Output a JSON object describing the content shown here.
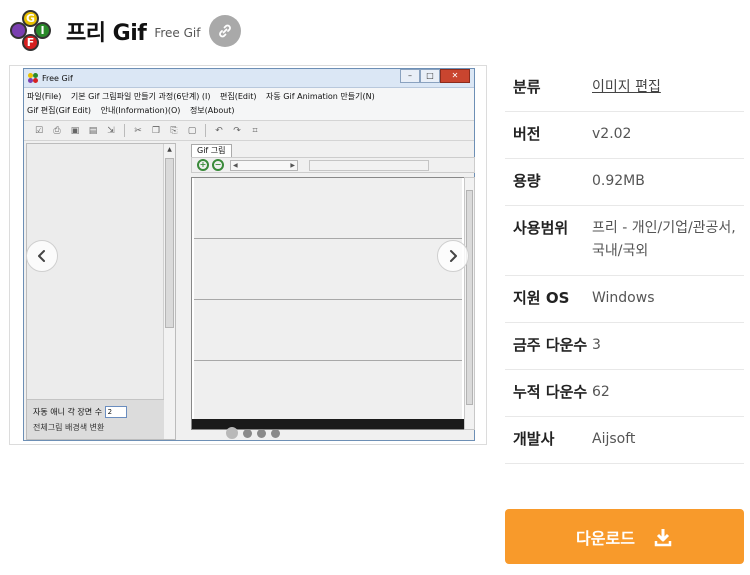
{
  "header": {
    "title": "프리 Gif",
    "subtitle": "Free Gif",
    "logo_letters": [
      "G",
      "I",
      "F"
    ]
  },
  "screenshot": {
    "window_title": "Free Gif",
    "menu": [
      "파일(File)",
      "기본 Gif 그림파일 만들기 과정(6단계) (I)",
      "편집(Edit)",
      "자동 Gif Animation 만들기(N)",
      "Gif 편집(Gif Edit)",
      "안내(Information)(O)",
      "정보(About)"
    ],
    "tab_label": "Gif 그림",
    "left_label": "자동 애니 각 장면 수",
    "stepper_value": "2",
    "left_label2": "전체그림 배경색 변환",
    "slide_count": 4,
    "active_slide": 1
  },
  "info": {
    "rows": [
      {
        "key": "분류",
        "value": "이미지 편집",
        "is_link": true
      },
      {
        "key": "버전",
        "value": "v2.02"
      },
      {
        "key": "용량",
        "value": "0.92MB"
      },
      {
        "key": "사용범위",
        "value": "프리 - 개인/기업/관공서, 국내/국외"
      },
      {
        "key": "지원 OS",
        "value": "Windows"
      },
      {
        "key": "금주 다운수",
        "value": "3"
      },
      {
        "key": "누적 다운수",
        "value": "62"
      },
      {
        "key": "개발사",
        "value": "Aijsoft"
      }
    ]
  },
  "download_button": {
    "label": "다운로드"
  },
  "colors": {
    "accent": "#f89a2b",
    "link_button": "#a9a9a9"
  },
  "icons": {
    "link": "link-icon",
    "download": "download-icon",
    "prev": "chevron-left-icon",
    "next": "chevron-right-icon"
  }
}
